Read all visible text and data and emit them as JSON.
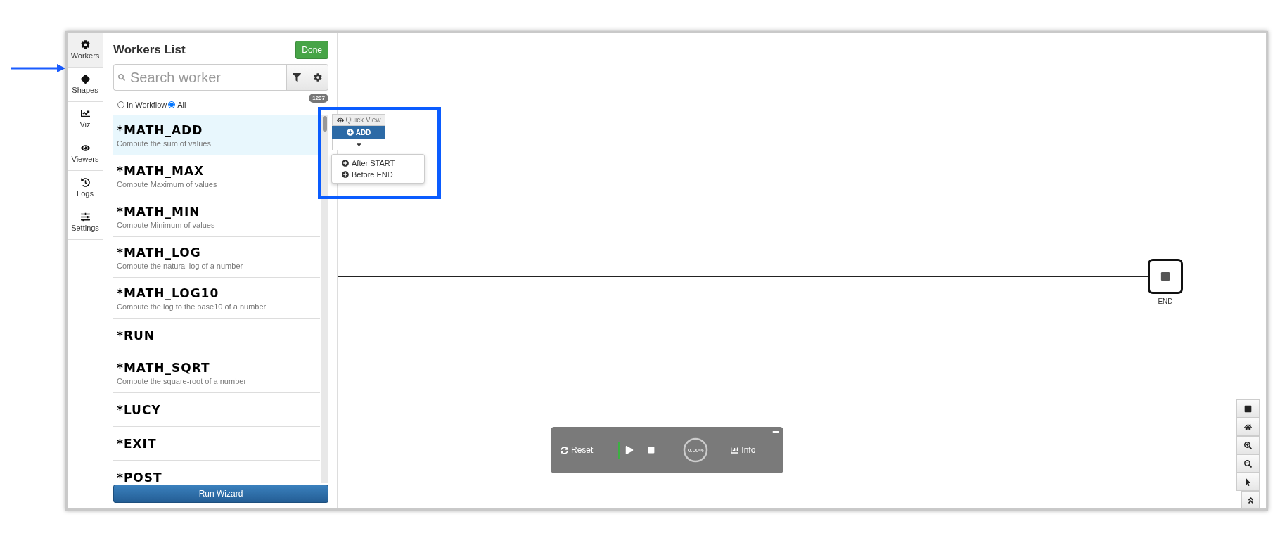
{
  "sidebar": {
    "tabs": [
      {
        "label": "Workers",
        "selected": true
      },
      {
        "label": "Shapes",
        "selected": false
      },
      {
        "label": "Viz",
        "selected": false
      },
      {
        "label": "Viewers",
        "selected": false
      },
      {
        "label": "Logs",
        "selected": false
      },
      {
        "label": "Settings",
        "selected": false
      }
    ]
  },
  "workers_panel": {
    "title": "Workers List",
    "done_button": "Done",
    "search": {
      "placeholder": "Search worker"
    },
    "count": "1237",
    "scope_options": [
      {
        "label": "In Workflow",
        "selected": false
      },
      {
        "label": "All",
        "selected": true
      }
    ],
    "items": [
      {
        "name": "*MATH_ADD",
        "description": "Compute the sum of values",
        "selected": true
      },
      {
        "name": "*MATH_MAX",
        "description": "Compute Maximum of values",
        "selected": false
      },
      {
        "name": "*MATH_MIN",
        "description": "Compute Minimum of values",
        "selected": false
      },
      {
        "name": "*MATH_LOG",
        "description": "Compute the natural log of a number",
        "selected": false
      },
      {
        "name": "*MATH_LOG10",
        "description": "Compute the log to the base10 of a number",
        "selected": false
      },
      {
        "name": "*RUN",
        "selected": false
      },
      {
        "name": "*MATH_SQRT",
        "description": "Compute the square-root of a number",
        "selected": false
      },
      {
        "name": "*LUCY",
        "selected": false
      },
      {
        "name": "*EXIT",
        "selected": false
      },
      {
        "name": "*POST",
        "selected": false
      }
    ],
    "run_button": "Run Wizard"
  },
  "worker_popup": {
    "quick_view": "Quick View",
    "add_button": "ADD",
    "menu": [
      "After START",
      "Before END"
    ]
  },
  "canvas": {
    "end_node": {
      "label": "END"
    }
  },
  "run_controls": {
    "reset": "Reset",
    "progress": {
      "reading": "0.00%"
    },
    "info": "Info"
  }
}
